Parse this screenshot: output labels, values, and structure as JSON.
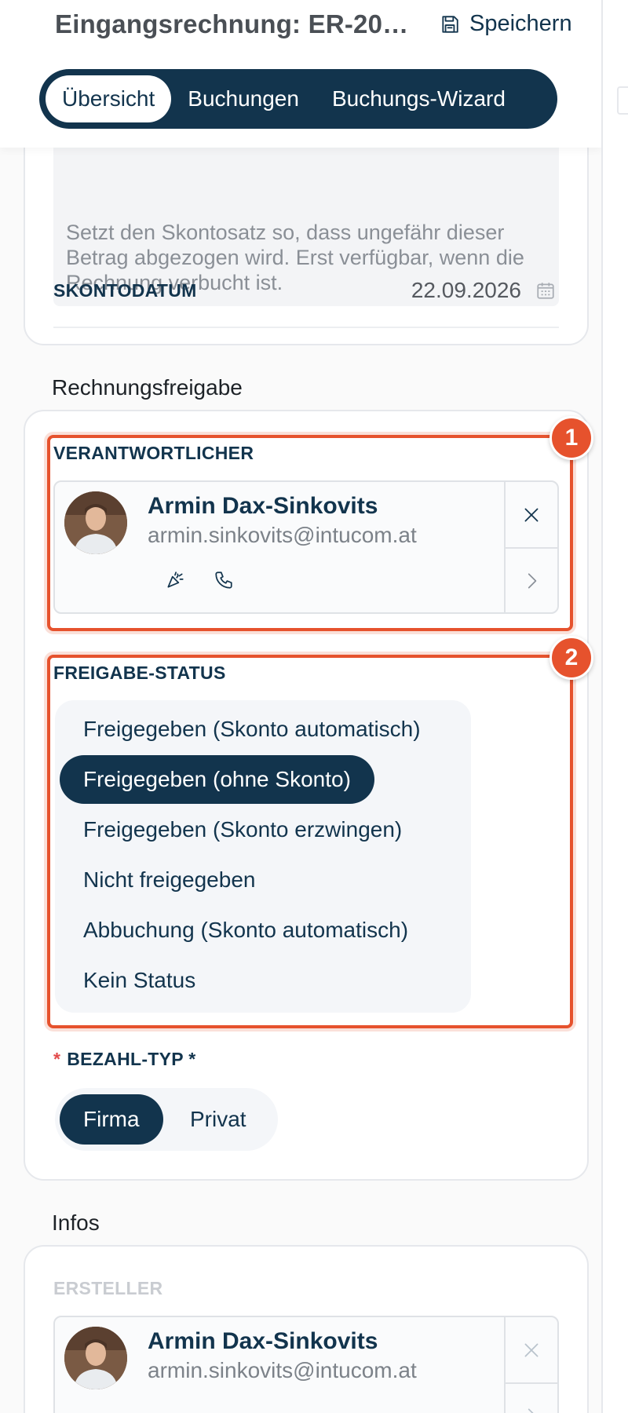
{
  "header": {
    "title": "Eingangsrechnung: ER-20…",
    "save_label": "Speichern",
    "tabs": [
      {
        "label": "Übersicht",
        "active": true
      },
      {
        "label": "Buchungen",
        "active": false
      },
      {
        "label": "Buchungs-Wizard",
        "active": false
      }
    ]
  },
  "skonto": {
    "hint_text": "Setzt den Skontosatz so, dass ungefähr dieser Betrag abgezogen wird. Erst verfügbar, wenn die Rechnung verbucht ist.",
    "date_label": "SKONTODATUM",
    "date_value": "22.09.2026",
    "date_icon": "calendar-icon"
  },
  "release": {
    "section_title": "Rechnungsfreigabe",
    "responsible_label": "VERANTWORTLICHER",
    "responsible": {
      "name": "Armin Dax-Sinkovits",
      "email": "armin.sinkovits@intucom.at",
      "action_icons": [
        "party-popper-icon",
        "phone-icon"
      ]
    },
    "status_label": "FREIGABE-STATUS",
    "status_options": [
      {
        "label": "Freigegeben (Skonto automatisch)",
        "active": false
      },
      {
        "label": "Freigegeben (ohne Skonto)",
        "active": true
      },
      {
        "label": "Freigegeben (Skonto erzwingen)",
        "active": false
      },
      {
        "label": "Nicht freigegeben",
        "active": false
      },
      {
        "label": "Abbuchung (Skonto automatisch)",
        "active": false
      },
      {
        "label": "Kein Status",
        "active": false
      }
    ],
    "payment_required_mark": "*",
    "payment_label": "BEZAHL-TYP *",
    "payment_options": [
      {
        "label": "Firma",
        "active": true
      },
      {
        "label": "Privat",
        "active": false
      }
    ]
  },
  "annotations": [
    {
      "number": "1"
    },
    {
      "number": "2"
    }
  ],
  "info": {
    "section_title": "Infos",
    "creator_label": "ERSTELLER",
    "creator": {
      "name": "Armin Dax-Sinkovits",
      "email": "armin.sinkovits@intucom.at"
    }
  },
  "colors": {
    "primary": "#12344d",
    "highlight": "#e6522d",
    "required": "#e24b4b"
  }
}
